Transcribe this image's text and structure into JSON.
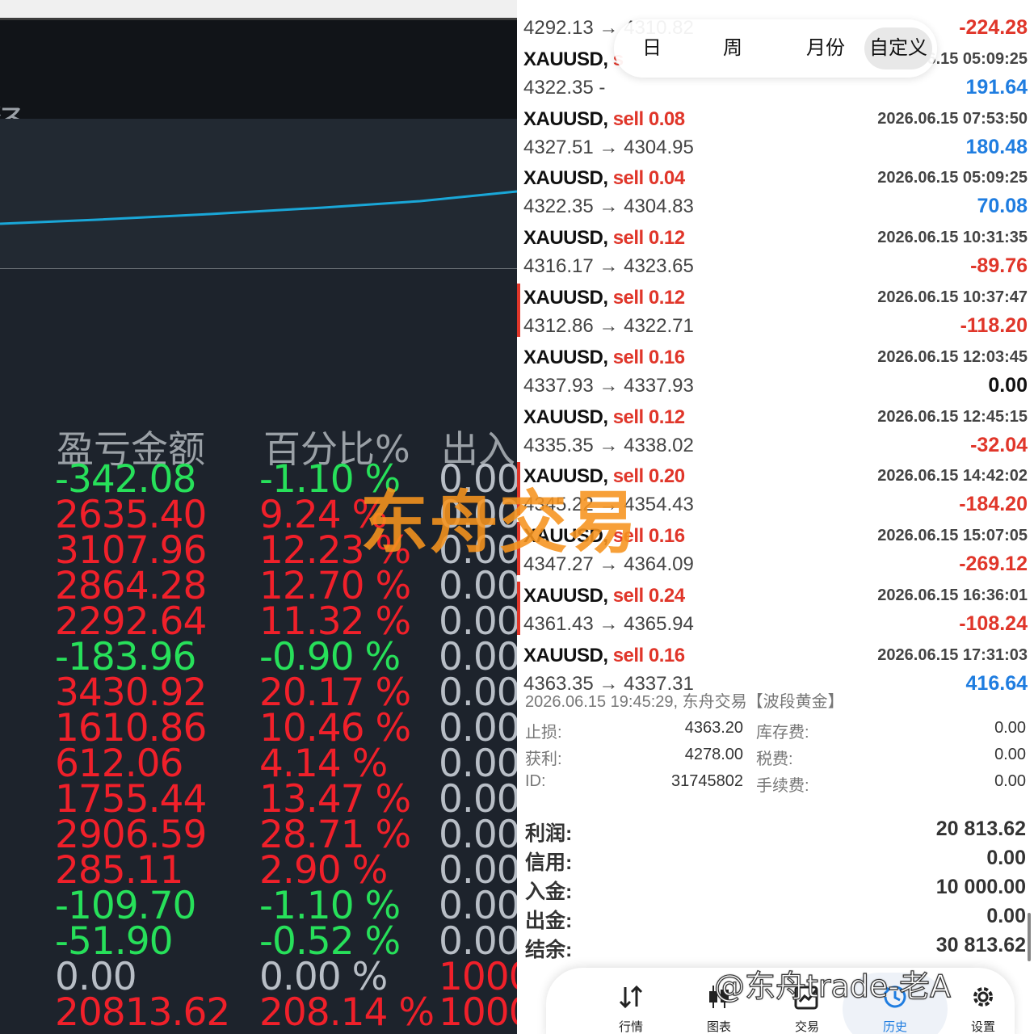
{
  "left_panel": {
    "header_partial_char": "径",
    "column_headers": {
      "amount": "盈亏金额",
      "percent": "百分比%",
      "io": "出入"
    },
    "rows": [
      {
        "amount": "-342.08",
        "percent": "-1.10 %",
        "io": "0.00",
        "sign": "neg"
      },
      {
        "amount": "2635.40",
        "percent": "9.24 %",
        "io": "0.00",
        "sign": "pos"
      },
      {
        "amount": "3107.96",
        "percent": "12.23 %",
        "io": "0.00",
        "sign": "pos"
      },
      {
        "amount": "2864.28",
        "percent": "12.70 %",
        "io": "0.00",
        "sign": "pos"
      },
      {
        "amount": "2292.64",
        "percent": "11.32 %",
        "io": "0.00",
        "sign": "pos"
      },
      {
        "amount": "-183.96",
        "percent": "-0.90 %",
        "io": "0.00",
        "sign": "neg"
      },
      {
        "amount": "3430.92",
        "percent": "20.17 %",
        "io": "0.00",
        "sign": "pos"
      },
      {
        "amount": "1610.86",
        "percent": "10.46 %",
        "io": "0.00",
        "sign": "pos"
      },
      {
        "amount": "612.06",
        "percent": "4.14 %",
        "io": "0.00",
        "sign": "pos"
      },
      {
        "amount": "1755.44",
        "percent": "13.47 %",
        "io": "0.00",
        "sign": "pos"
      },
      {
        "amount": "2906.59",
        "percent": "28.71 %",
        "io": "0.00",
        "sign": "pos"
      },
      {
        "amount": "285.11",
        "percent": "2.90 %",
        "io": "0.00",
        "sign": "pos"
      },
      {
        "amount": "-109.70",
        "percent": "-1.10 %",
        "io": "0.00",
        "sign": "neg"
      },
      {
        "amount": "-51.90",
        "percent": "-0.52 %",
        "io": "0.00",
        "sign": "neg"
      },
      {
        "amount": "0.00",
        "percent": "0.00 %",
        "io": "1000",
        "sign": "zero"
      },
      {
        "amount": "20813.62",
        "percent": "208.14 %",
        "io": "1000",
        "sign": "pos"
      }
    ],
    "chart_line_color": "#1aa7d8"
  },
  "tabs": {
    "day": "日",
    "week": "周",
    "month": "月份",
    "custom": "自定义",
    "active": "custom"
  },
  "trades": [
    {
      "symbol": "",
      "side": "",
      "time": "",
      "prices": "4292.13 → 4310.82",
      "profit": "-224.28",
      "color": "red",
      "mark": false
    },
    {
      "symbol": "XAUUSD,",
      "side": "s",
      "time": "6.15 05:09:25",
      "prices": "4322.35 -",
      "profit": "191.64",
      "color": "blue",
      "mark": false
    },
    {
      "symbol": "XAUUSD,",
      "side": "sell 0.08",
      "time": "2026.06.15 07:53:50",
      "prices": "4327.51 → 4304.95",
      "profit": "180.48",
      "color": "blue",
      "mark": false
    },
    {
      "symbol": "XAUUSD,",
      "side": "sell 0.04",
      "time": "2026.06.15 05:09:25",
      "prices": "4322.35 → 4304.83",
      "profit": "70.08",
      "color": "blue",
      "mark": false
    },
    {
      "symbol": "XAUUSD,",
      "side": "sell 0.12",
      "time": "2026.06.15 10:31:35",
      "prices": "4316.17 → 4323.65",
      "profit": "-89.76",
      "color": "red",
      "mark": false
    },
    {
      "symbol": "XAUUSD,",
      "side": "sell 0.12",
      "time": "2026.06.15 10:37:47",
      "prices": "4312.86 → 4322.71",
      "profit": "-118.20",
      "color": "red",
      "mark": true
    },
    {
      "symbol": "XAUUSD,",
      "side": "sell 0.16",
      "time": "2026.06.15 12:03:45",
      "prices": "4337.93 → 4337.93",
      "profit": "0.00",
      "color": "black",
      "mark": false
    },
    {
      "symbol": "XAUUSD,",
      "side": "sell 0.12",
      "time": "2026.06.15 12:45:15",
      "prices": "4335.35 → 4338.02",
      "profit": "-32.04",
      "color": "red",
      "mark": false
    },
    {
      "symbol": "XAUUSD,",
      "side": "sell 0.20",
      "time": "2026.06.15 14:42:02",
      "prices": "4345.22 → 4354.43",
      "profit": "-184.20",
      "color": "red",
      "mark": true
    },
    {
      "symbol": "XAUUSD,",
      "side": "sell 0.16",
      "time": "2026.06.15 15:07:05",
      "prices": "4347.27 → 4364.09",
      "profit": "-269.12",
      "color": "red",
      "mark": true
    },
    {
      "symbol": "XAUUSD,",
      "side": "sell 0.24",
      "time": "2026.06.15 16:36:01",
      "prices": "4361.43 → 4365.94",
      "profit": "-108.24",
      "color": "red",
      "mark": true
    },
    {
      "symbol": "XAUUSD,",
      "side": "sell 0.16",
      "time": "2026.06.15 17:31:03",
      "prices": "4363.35 → 4337.31",
      "profit": "416.64",
      "color": "blue",
      "mark": false
    }
  ],
  "detail": {
    "title": "2026.06.15 19:45:29, 东舟交易【波段黄金】",
    "stop_loss_label": "止损:",
    "stop_loss": "4363.20",
    "take_profit_label": "获利:",
    "take_profit": "4278.00",
    "id_label": "ID:",
    "id": "31745802",
    "swap_label": "库存费:",
    "swap": "0.00",
    "tax_label": "税费:",
    "tax": "0.00",
    "commission_label": "手续费:",
    "commission": "0.00"
  },
  "summary": {
    "profit_label": "利润:",
    "profit": "20 813.62",
    "credit_label": "信用:",
    "credit": "0.00",
    "deposit_label": "入金:",
    "deposit": "10 000.00",
    "withdraw_label": "出金:",
    "withdraw": "0.00",
    "balance_label": "结余:",
    "balance": "30 813.62"
  },
  "nav": {
    "quotes": "行情",
    "chart": "图表",
    "trade": "交易",
    "history": "历史",
    "settings": "设置",
    "active": "history"
  },
  "overlay": {
    "watermark": "东舟交易",
    "credit": "@东舟trade-老A",
    "watermark_color": "#f7941e"
  }
}
